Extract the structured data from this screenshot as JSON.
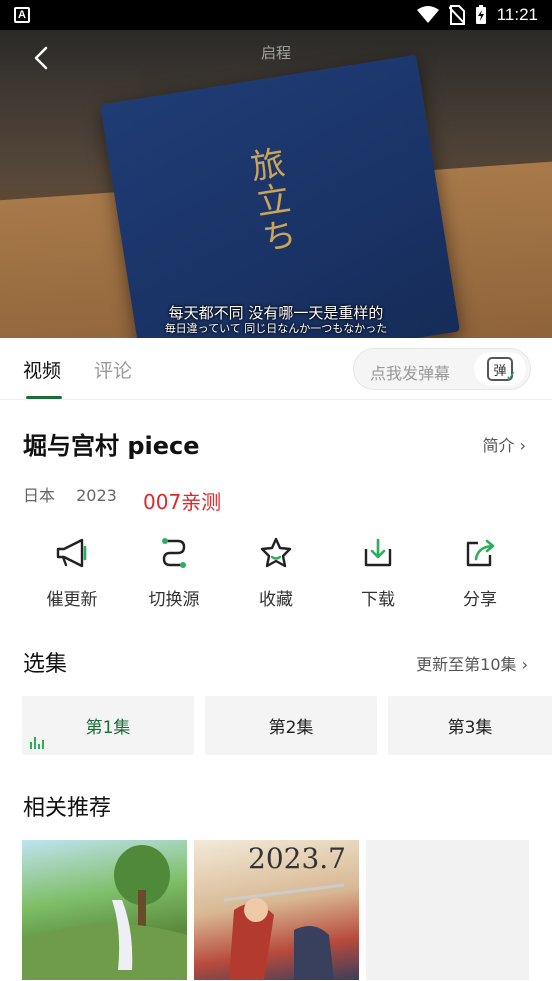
{
  "status_bar": {
    "time": "11:21",
    "left_icon": "A"
  },
  "player": {
    "title": "启程",
    "cover_text": "旅立ち",
    "subtitle_cn": "每天都不同  没有哪一天是重样的",
    "subtitle_jp": "毎日違っていて  同じ日なんか一つもなかった"
  },
  "tabs": {
    "video": "视频",
    "comments": "评论"
  },
  "danmu": {
    "placeholder": "点我发弹幕",
    "button": "弹"
  },
  "show": {
    "title": "堀与宫村 piece",
    "intro_link": "简介 ›",
    "region": "日本",
    "year": "2023",
    "note": "007亲测"
  },
  "actions": [
    {
      "label": "催更新",
      "icon": "megaphone-icon"
    },
    {
      "label": "切换源",
      "icon": "switch-source-icon"
    },
    {
      "label": "收藏",
      "icon": "star-icon"
    },
    {
      "label": "下载",
      "icon": "download-icon"
    },
    {
      "label": "分享",
      "icon": "share-icon"
    }
  ],
  "episodes": {
    "section_title": "选集",
    "update_info": "更新至第10集 ›",
    "items": [
      "第1集",
      "第2集",
      "第3集"
    ]
  },
  "recommend": {
    "section_title": "相关推荐",
    "card2_text": "2023.7"
  },
  "colors": {
    "accent": "#1e6b3a",
    "note": "#e0282b"
  }
}
